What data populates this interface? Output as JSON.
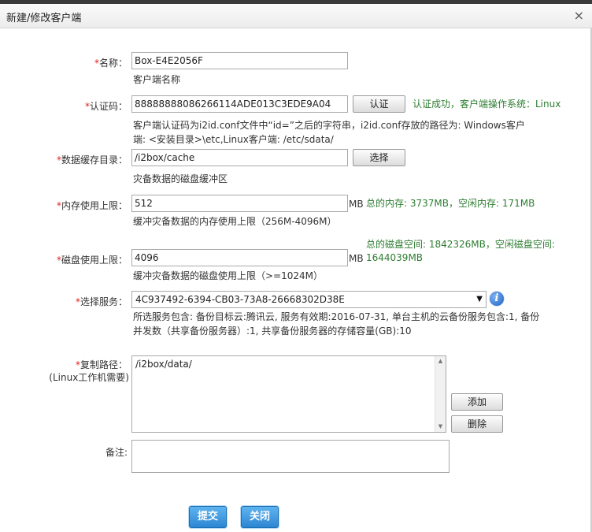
{
  "dialog": {
    "title": "新建/修改客户端",
    "close_glyph": "×"
  },
  "form": {
    "required_mark": "*",
    "name": {
      "label": "名称：",
      "value": "Box-E4E2056F",
      "hint": "客户端名称"
    },
    "auth_code": {
      "label": "认证码：",
      "value": "88888888086266114ADE013C3EDE9A04",
      "button": "认证",
      "status": "认证成功，客户端操作系统：Linux",
      "hint_line1": "客户端认证码为i2id.conf文件中“id=”之后的字符串，i2id.conf存放的路径为: Windows客户",
      "hint_line2": "端: <安装目录>\\etc,Linux客户端: /etc/sdata/"
    },
    "cache_dir": {
      "label": "数据缓存目录：",
      "value": "/i2box/cache",
      "button": "选择",
      "hint": "灾备数据的磁盘缓冲区"
    },
    "memory_limit": {
      "label": "内存使用上限：",
      "value": "512",
      "unit": "MB",
      "info": "总的内存: 3737MB，空闲内存: 171MB",
      "hint": "缓冲灾备数据的内存使用上限（256M-4096M）"
    },
    "disk_limit": {
      "label": "磁盘使用上限：",
      "value": "4096",
      "unit": "MB",
      "info_line1": "总的磁盘空间: 1842326MB，空闲磁盘空间:",
      "info_line2": "1644039MB",
      "hint": "缓冲灾备数据的磁盘使用上限（>=1024M）"
    },
    "service": {
      "label": "选择服务：",
      "selected": "4C937492-6394-CB03-73A8-26668302D38E",
      "info_icon": "info-icon",
      "desc_line1": "所选服务包含: 备份目标云:腾讯云, 服务有效期:2016-07-31, 单台主机的云备份服务包含:1, 备份",
      "desc_line2": "并发数（共享备份服务器）:1, 共享备份服务器的存储容量(GB):10"
    },
    "copy_path": {
      "label": "复制路径：",
      "sublabel": "(Linux工作机需要)",
      "value": "/i2box/data/",
      "add_button": "添加",
      "delete_button": "删除"
    },
    "remark": {
      "label": "备注:",
      "value": ""
    }
  },
  "actions": {
    "submit": "提交",
    "close": "关闭"
  },
  "colors": {
    "accent_blue": "#2d86d3",
    "success_green": "#2e7d32",
    "required_red": "#e02020"
  }
}
